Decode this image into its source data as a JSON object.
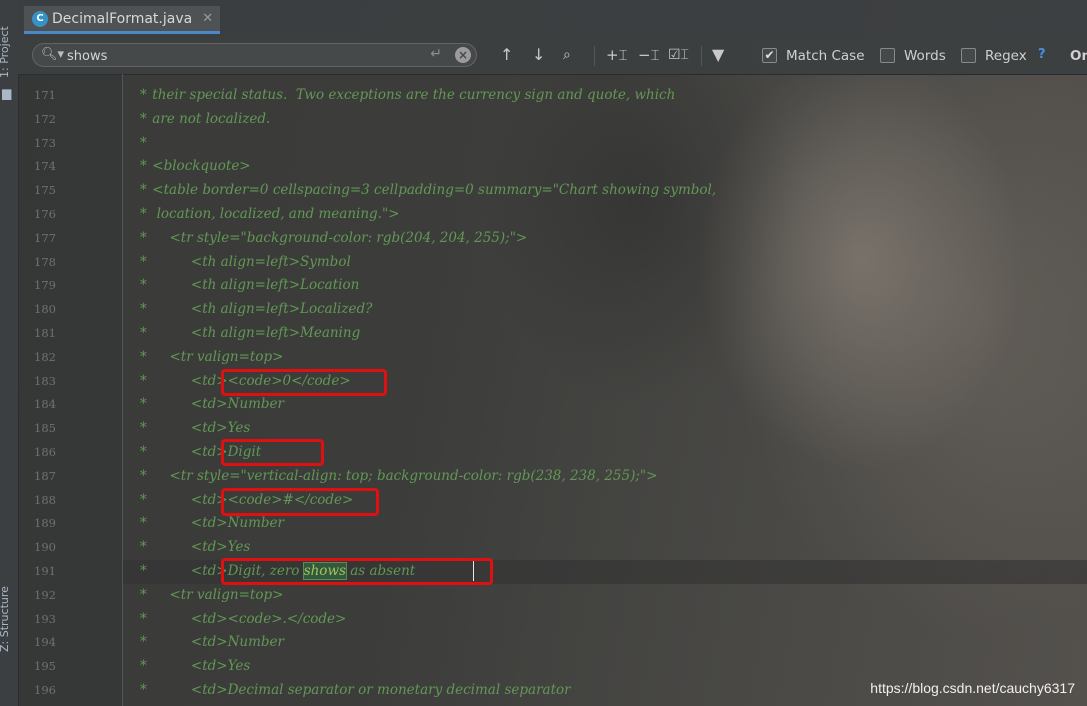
{
  "sidebar": {
    "project_label": "1: Project",
    "structure_label": "Z: Structure"
  },
  "tab": {
    "title": "DecimalFormat.java",
    "icon_letter": "C"
  },
  "search": {
    "query": "shows",
    "match_case_label": "Match Case",
    "match_case_checked": true,
    "words_label": "Words",
    "regex_label": "Regex",
    "help_label": "?",
    "trailing_label": "On"
  },
  "lines": [
    {
      "no": "171",
      "text": " their special status.  Two exceptions are the currency sign and quote, which"
    },
    {
      "no": "172",
      "text": " are not localized."
    },
    {
      "no": "173",
      "text": ""
    },
    {
      "no": "174",
      "text": " <blockquote>"
    },
    {
      "no": "175",
      "text": " <table border=0 cellspacing=3 cellpadding=0 summary=\"Chart showing symbol,"
    },
    {
      "no": "176",
      "text": "  location, localized, and meaning.\">"
    },
    {
      "no": "177",
      "text": "     <tr style=\"background-color: rgb(204, 204, 255);\">"
    },
    {
      "no": "178",
      "text": "          <th align=left>Symbol"
    },
    {
      "no": "179",
      "text": "          <th align=left>Location"
    },
    {
      "no": "180",
      "text": "          <th align=left>Localized?"
    },
    {
      "no": "181",
      "text": "          <th align=left>Meaning"
    },
    {
      "no": "182",
      "text": "     <tr valign=top>"
    },
    {
      "no": "183",
      "text": "          <td><code>0</code>"
    },
    {
      "no": "184",
      "text": "          <td>Number"
    },
    {
      "no": "185",
      "text": "          <td>Yes"
    },
    {
      "no": "186",
      "text": "          <td>Digit"
    },
    {
      "no": "187",
      "text": "     <tr style=\"vertical-align: top; background-color: rgb(238, 238, 255);\">"
    },
    {
      "no": "188",
      "text": "          <td><code>#</code>"
    },
    {
      "no": "189",
      "text": "          <td>Number"
    },
    {
      "no": "190",
      "text": "          <td>Yes"
    },
    {
      "no": "191",
      "pre": "          <td>Digit, zero ",
      "match": "shows",
      "post": " as absent"
    },
    {
      "no": "192",
      "text": "     <tr valign=top>"
    },
    {
      "no": "193",
      "text": "          <td><code>.</code>"
    },
    {
      "no": "194",
      "text": "          <td>Number"
    },
    {
      "no": "195",
      "text": "          <td>Yes"
    },
    {
      "no": "196",
      "text": "          <td>Decimal separator or monetary decimal separator"
    }
  ],
  "watermark": "https://blog.csdn.net/cauchy6317",
  "colors": {
    "comment": "#629755",
    "match_highlight": "#32593d",
    "annotation_box": "#e01010",
    "tab_underline": "#4a88c7"
  }
}
